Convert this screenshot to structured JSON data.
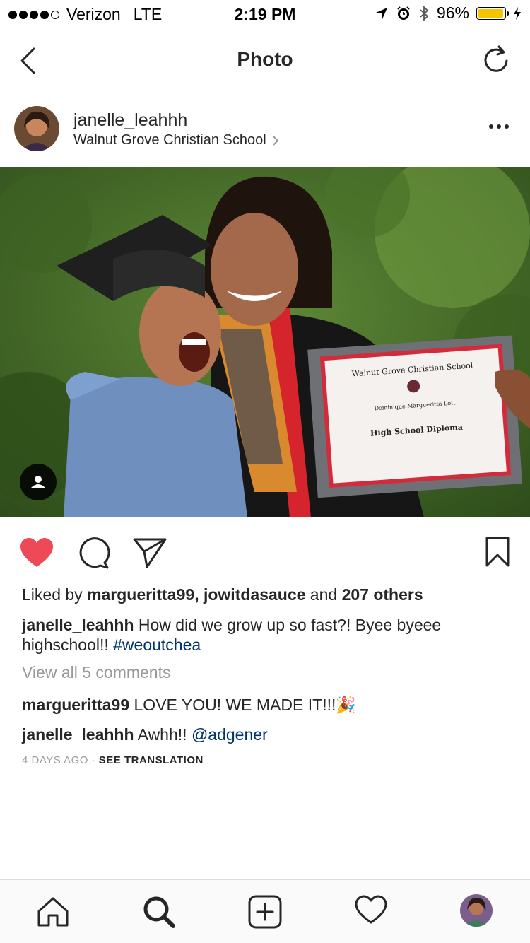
{
  "status_bar": {
    "carrier": "Verizon",
    "network": "LTE",
    "time": "2:19 PM",
    "battery": "96%",
    "battery_level": 0.96,
    "signal_bars": 4
  },
  "nav": {
    "title": "Photo"
  },
  "post": {
    "username": "janelle_leahhh",
    "location": "Walnut Grove Christian School",
    "liked": true,
    "likes": {
      "prefix": "Liked by",
      "user1": "margueritta99",
      "user2": "jowitdasauce",
      "and": "and",
      "others": "207 others"
    },
    "caption": {
      "username": "janelle_leahhh",
      "text": "How did we grow up so fast?! Byee byeee highschool!!",
      "hashtag": "#weoutchea"
    },
    "view_all_comments": "View all 5 comments",
    "comments": [
      {
        "username": "margueritta99",
        "text": "LOVE YOU! WE MADE IT!!!🎉"
      },
      {
        "username": "janelle_leahhh",
        "text": "Awhh!!",
        "mention": "@adgener"
      }
    ],
    "timestamp": "4 DAYS AGO",
    "separator": "·",
    "see_translation": "SEE TRANSLATION"
  },
  "photo_content": {
    "certificate_school": "Walnut Grove Christian School",
    "certificate_title": "High School Diploma",
    "certificate_name": "Dominique Margueritta Lott"
  },
  "colors": {
    "like_red": "#ed4956",
    "link_blue": "#003569",
    "muted_gray": "#999999",
    "battery_yellow": "#f6c400"
  },
  "icons": [
    "back-icon",
    "refresh-icon",
    "more-icon",
    "chevron-right-icon",
    "user-tag-icon",
    "heart-icon",
    "comment-icon",
    "share-icon",
    "bookmark-icon",
    "home-icon",
    "search-icon",
    "add-icon",
    "activity-icon",
    "profile-icon"
  ]
}
